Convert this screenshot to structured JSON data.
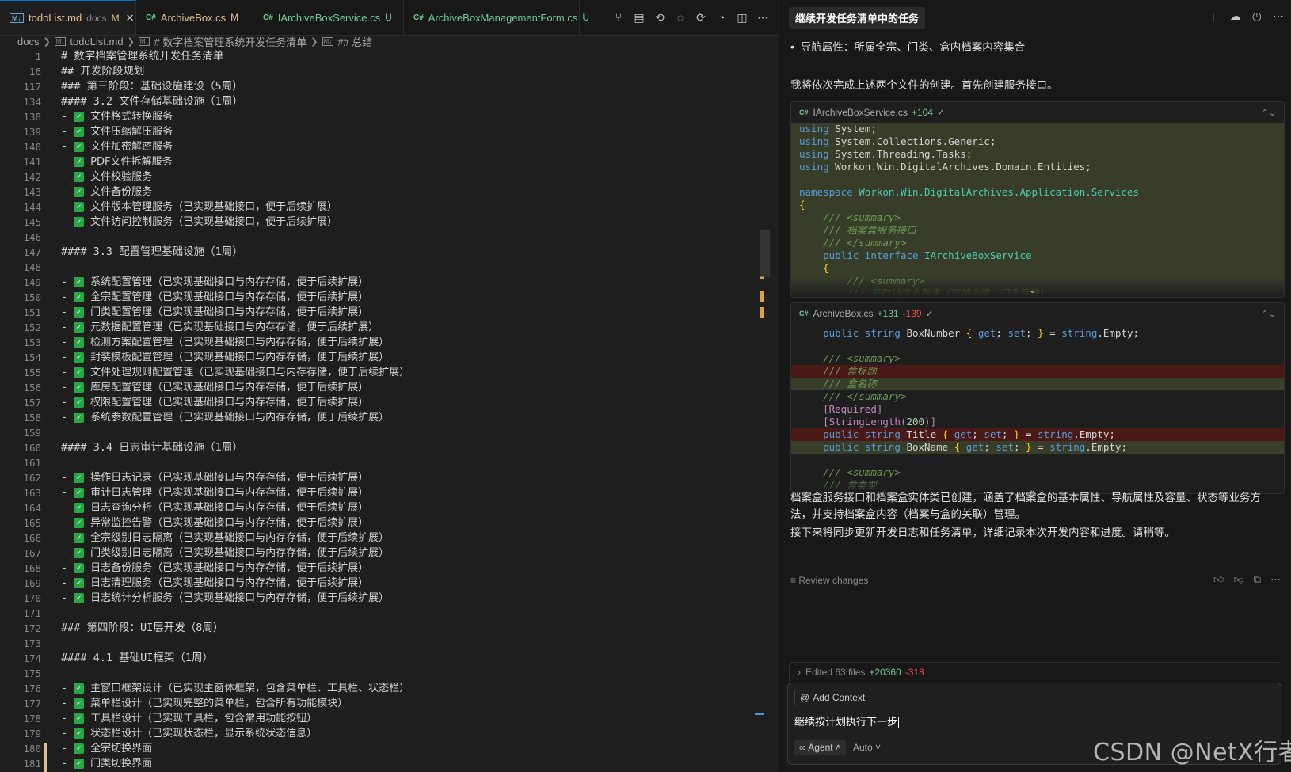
{
  "tabs": [
    {
      "icon": "M↓",
      "icon_type": "md",
      "name": "todoList.md",
      "dir": "docs",
      "status": "M",
      "active": true,
      "closable": true
    },
    {
      "icon": "C#",
      "icon_type": "cs",
      "name": "ArchiveBox.cs",
      "dir": "",
      "status": "M",
      "active": false
    },
    {
      "icon": "C#",
      "icon_type": "cs",
      "name": "IArchiveBoxService.cs",
      "dir": "",
      "status": "U",
      "active": false
    },
    {
      "icon": "C#",
      "icon_type": "cs",
      "name": "ArchiveBoxManagementForm.cs",
      "dir": "",
      "status": "U",
      "active": false
    }
  ],
  "tab_actions": [
    "source-control-icon",
    "preview-icon",
    "go-back-icon",
    "go-circle-icon",
    "go-forward-icon",
    "timeline-icon",
    "split-editor-icon",
    "more-icon"
  ],
  "breadcrumb": {
    "folder": "docs",
    "file": "todoList.md",
    "section1": "# 数字档案管理系统开发任务清单",
    "section2": "## 总结"
  },
  "editor_lines": [
    {
      "num": "1",
      "text": "# 数字档案管理系统开发任务清单"
    },
    {
      "num": "16",
      "text": "## 开发阶段规划"
    },
    {
      "num": "117",
      "text": "### 第三阶段：基础设施建设（5周）"
    },
    {
      "num": "134",
      "text": "#### 3.2 文件存储基础设施（1周）"
    },
    {
      "num": "138",
      "text": "文件格式转换服务",
      "check": true
    },
    {
      "num": "139",
      "text": "文件压缩解压服务",
      "check": true
    },
    {
      "num": "140",
      "text": "文件加密解密服务",
      "check": true
    },
    {
      "num": "141",
      "text": "PDF文件拆解服务",
      "check": true
    },
    {
      "num": "142",
      "text": "文件校验服务",
      "check": true
    },
    {
      "num": "143",
      "text": "文件备份服务",
      "check": true
    },
    {
      "num": "144",
      "text": "文件版本管理服务（已实现基础接口，便于后续扩展）",
      "check": true
    },
    {
      "num": "145",
      "text": "文件访问控制服务（已实现基础接口，便于后续扩展）",
      "check": true
    },
    {
      "num": "146",
      "text": ""
    },
    {
      "num": "147",
      "text": "#### 3.3 配置管理基础设施（1周）"
    },
    {
      "num": "148",
      "text": ""
    },
    {
      "num": "149",
      "text": "系统配置管理（已实现基础接口与内存存储，便于后续扩展）",
      "check": true
    },
    {
      "num": "150",
      "text": "全宗配置管理（已实现基础接口与内存存储，便于后续扩展）",
      "check": true
    },
    {
      "num": "151",
      "text": "门类配置管理（已实现基础接口与内存存储，便于后续扩展）",
      "check": true
    },
    {
      "num": "152",
      "text": "元数据配置管理（已实现基础接口与内存存储，便于后续扩展）",
      "check": true
    },
    {
      "num": "153",
      "text": "检测方案配置管理（已实现基础接口与内存存储，便于后续扩展）",
      "check": true
    },
    {
      "num": "154",
      "text": "封装模板配置管理（已实现基础接口与内存存储，便于后续扩展）",
      "check": true
    },
    {
      "num": "155",
      "text": "文件处理规则配置管理（已实现基础接口与内存存储，便于后续扩展）",
      "check": true
    },
    {
      "num": "156",
      "text": "库房配置管理（已实现基础接口与内存存储，便于后续扩展）",
      "check": true
    },
    {
      "num": "157",
      "text": "权限配置管理（已实现基础接口与内存存储，便于后续扩展）",
      "check": true
    },
    {
      "num": "158",
      "text": "系统参数配置管理（已实现基础接口与内存存储，便于后续扩展）",
      "check": true
    },
    {
      "num": "159",
      "text": ""
    },
    {
      "num": "160",
      "text": "#### 3.4 日志审计基础设施（1周）"
    },
    {
      "num": "161",
      "text": ""
    },
    {
      "num": "162",
      "text": "操作日志记录（已实现基础接口与内存存储，便于后续扩展）",
      "check": true
    },
    {
      "num": "163",
      "text": "审计日志管理（已实现基础接口与内存存储，便于后续扩展）",
      "check": true
    },
    {
      "num": "164",
      "text": "日志查询分析（已实现基础接口与内存存储，便于后续扩展）",
      "check": true
    },
    {
      "num": "165",
      "text": "异常监控告警（已实现基础接口与内存存储，便于后续扩展）",
      "check": true
    },
    {
      "num": "166",
      "text": "全宗级别日志隔离（已实现基础接口与内存存储，便于后续扩展）",
      "check": true
    },
    {
      "num": "167",
      "text": "门类级别日志隔离（已实现基础接口与内存存储，便于后续扩展）",
      "check": true
    },
    {
      "num": "168",
      "text": "日志备份服务（已实现基础接口与内存存储，便于后续扩展）",
      "check": true
    },
    {
      "num": "169",
      "text": "日志清理服务（已实现基础接口与内存存储，便于后续扩展）",
      "check": true
    },
    {
      "num": "170",
      "text": "日志统计分析服务（已实现基础接口与内存存储，便于后续扩展）",
      "check": true
    },
    {
      "num": "171",
      "text": ""
    },
    {
      "num": "172",
      "text": "### 第四阶段：UI层开发（8周）"
    },
    {
      "num": "173",
      "text": ""
    },
    {
      "num": "174",
      "text": "#### 4.1 基础UI框架（1周）"
    },
    {
      "num": "175",
      "text": ""
    },
    {
      "num": "176",
      "text": "主窗口框架设计（已实现主窗体框架，包含菜单栏、工具栏、状态栏）",
      "check": true
    },
    {
      "num": "177",
      "text": "菜单栏设计（已实现完整的菜单栏，包含所有功能模块）",
      "check": true
    },
    {
      "num": "178",
      "text": "工具栏设计（已实现工具栏，包含常用功能按钮）",
      "check": true
    },
    {
      "num": "179",
      "text": "状态栏设计（已实现状态栏，显示系统状态信息）",
      "check": true
    },
    {
      "num": "180",
      "text": "全宗切换界面",
      "check": true
    },
    {
      "num": "181",
      "text": "门类切换界面",
      "check": true
    }
  ],
  "chat": {
    "title": "继续开发任务清单中的任务",
    "header_actions": [
      "new-chat-icon",
      "cloud-icon",
      "history-icon",
      "more-icon"
    ],
    "bullet": "导航属性：所属全宗、门类、盒内档案内容集合",
    "intro": "我将依次完成上述两个文件的创建。首先创建服务接口。",
    "card1": {
      "file": "IArchiveBoxService.cs",
      "added": "+104",
      "removed": "",
      "status": "✓"
    },
    "card2": {
      "file": "ArchiveBox.cs",
      "added": "+131",
      "removed": "-139",
      "status": "✓"
    },
    "summary": "档案盒服务接口和档案盒实体类已创建，涵盖了档案盒的基本属性、导航属性及容量、状态等业务方法，并支持档案盒内容（档案与盒的关联）管理。",
    "next": "接下来将同步更新开发日志和任务清单，详细记录本次开发内容和进度。请稍等。",
    "review": "Review changes",
    "edited": {
      "label": "Edited 63 files",
      "added": "+20360",
      "removed": "-318"
    },
    "add_context": "Add Context",
    "prompt": "继续按计划执行下一步",
    "agent": "Agent",
    "model": "Auto"
  },
  "watermark": "CSDN @NetX行者",
  "colors": {
    "check": "#28a745",
    "added_bg": "#373d29",
    "removed_bg": "#4b1818",
    "accent": "#0078d4",
    "modified": "#e2c08d",
    "untracked": "#73c991"
  }
}
